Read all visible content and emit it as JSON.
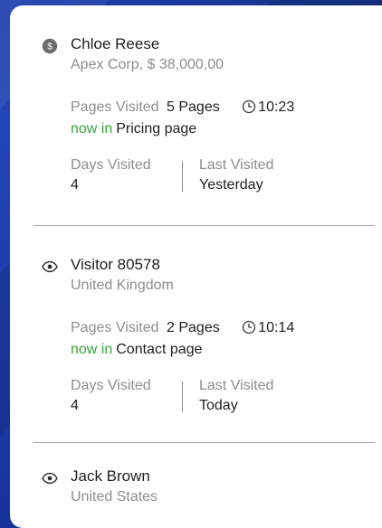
{
  "visitors": [
    {
      "icon": "dollar-circle-icon",
      "name": "Chloe Reese",
      "subtitle": "Apex Corp, $ 38,000,00",
      "pages_visited_label": "Pages Visited",
      "pages_visited_value": "5 Pages",
      "time": "10:23",
      "now_in_label": "now in",
      "now_in_value": "Pricing page",
      "days_visited_label": "Days Visited",
      "days_visited_value": "4",
      "last_visited_label": "Last Visited",
      "last_visited_value": "Yesterday"
    },
    {
      "icon": "eye-icon",
      "name": "Visitor 80578",
      "subtitle": "United Kingdom",
      "pages_visited_label": "Pages Visited",
      "pages_visited_value": "2 Pages",
      "time": "10:14",
      "now_in_label": "now in",
      "now_in_value": "Contact page",
      "days_visited_label": "Days Visited",
      "days_visited_value": "4",
      "last_visited_label": "Last Visited",
      "last_visited_value": "Today"
    },
    {
      "icon": "eye-icon",
      "name": "Jack Brown",
      "subtitle": "United States"
    }
  ],
  "colors": {
    "background": "#1f3fa6",
    "panel": "#ffffff",
    "muted_text": "#8d8d8d",
    "primary_text": "#1f1f1f",
    "now_in_green": "#38a43a",
    "divider": "#9ea7b3"
  }
}
